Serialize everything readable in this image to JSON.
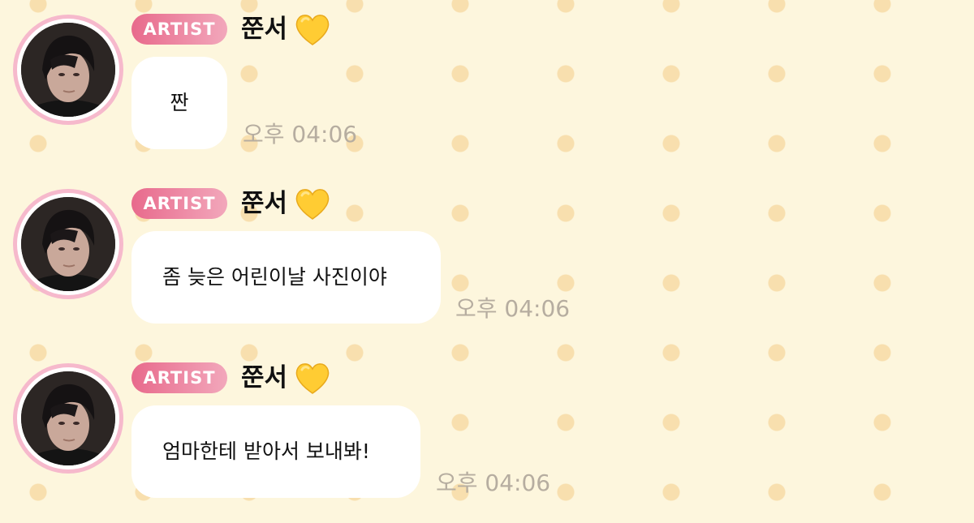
{
  "messages": [
    {
      "badge": "ARTIST",
      "sender": "쭌서",
      "heart_icon": "yellow-heart-icon",
      "text": "짠",
      "time": "오후 04:06"
    },
    {
      "badge": "ARTIST",
      "sender": "쭌서",
      "heart_icon": "yellow-heart-icon",
      "text": "좀 늦은 어린이날 사진이야",
      "time": "오후 04:06"
    },
    {
      "badge": "ARTIST",
      "sender": "쭌서",
      "heart_icon": "yellow-heart-icon",
      "text": "엄마한테 받아서 보내봐!",
      "time": "오후 04:06"
    }
  ],
  "colors": {
    "background": "#fdf6dd",
    "dots": "#f8dfae",
    "badge_start": "#e86a8c",
    "badge_end": "#f2a7bb",
    "avatar_ring": "#f6b9cc",
    "bubble": "#ffffff",
    "timestamp": "#b6ada0",
    "heart": "#ffcc33"
  }
}
